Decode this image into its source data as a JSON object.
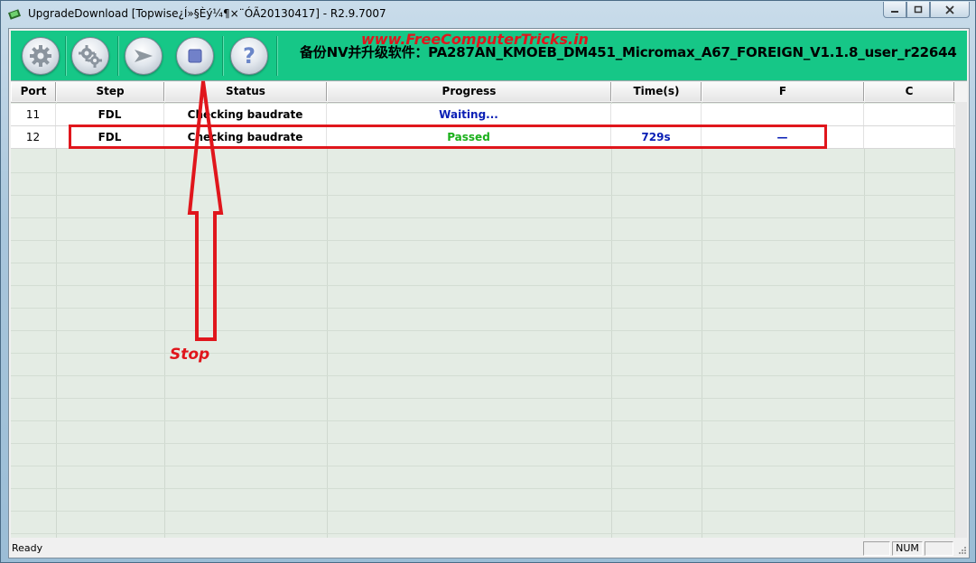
{
  "window": {
    "title": "UpgradeDownload [Topwise¿Í»§Èý¼¶×¨ÓÃ20130417] - R2.9.7007"
  },
  "toolbar": {
    "buttons": [
      {
        "name": "settings-button",
        "icon": "gear-icon"
      },
      {
        "name": "advanced-settings-button",
        "icon": "gears-icon"
      },
      {
        "name": "start-button",
        "icon": "play-arrow-icon"
      },
      {
        "name": "stop-button",
        "icon": "stop-icon"
      },
      {
        "name": "help-button",
        "icon": "question-icon"
      }
    ],
    "banner": "备份NV并升级软件：PA287AN_KMOEB_DM451_Micromax_A67_FOREIGN_V1.1.8_user_r22644"
  },
  "watermark": "www.FreeComputerTricks.in",
  "table": {
    "columns": [
      "Port",
      "Step",
      "Status",
      "Progress",
      "Time(s)",
      "F",
      "C"
    ],
    "rows": [
      {
        "port": "11",
        "step": "FDL",
        "status": "Checking baudrate",
        "progress": "Waiting...",
        "time": "",
        "f": "",
        "c": ""
      },
      {
        "port": "12",
        "step": "FDL",
        "status": "Checking baudrate",
        "progress": "Passed",
        "time": "729s",
        "f": "—",
        "c": ""
      }
    ]
  },
  "statusbar": {
    "text": "Ready",
    "num": "NUM"
  },
  "annotation": {
    "label": "Stop"
  },
  "colors": {
    "toolbar_bg": "#16c787",
    "waiting": "#0a1fb5",
    "passed": "#1bb01b",
    "time": "#0a1fb5",
    "annotation": "#e0161c"
  }
}
